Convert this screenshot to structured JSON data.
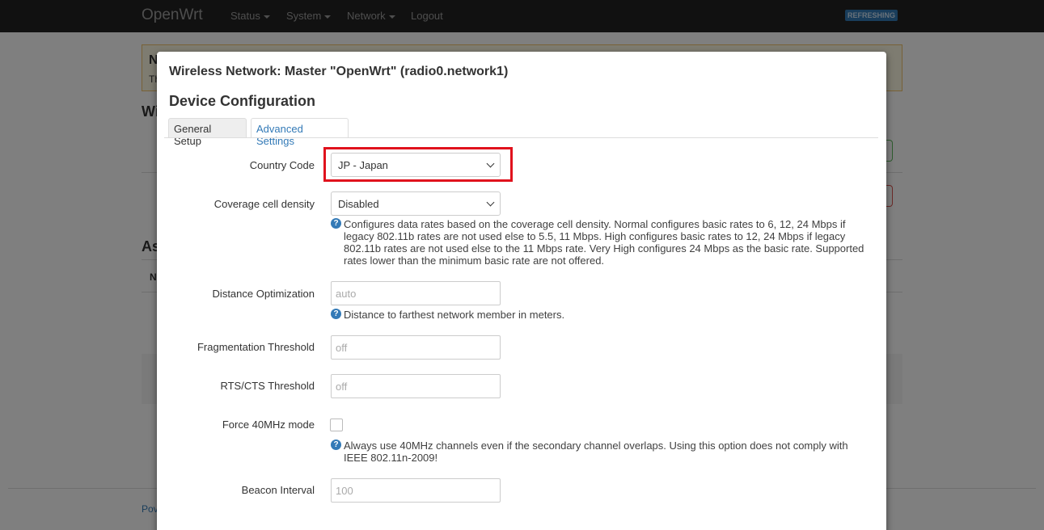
{
  "navbar": {
    "brand": "OpenWrt",
    "items": [
      {
        "label": "Status",
        "dropdown": true
      },
      {
        "label": "System",
        "dropdown": true
      },
      {
        "label": "Network",
        "dropdown": true
      },
      {
        "label": "Logout",
        "dropdown": false
      }
    ],
    "badge": "REFRESHING"
  },
  "background": {
    "notice_title": "N",
    "notice_text": "Th",
    "heading": "Wi",
    "heading2": "As",
    "row_label": "N",
    "footer": "Pov"
  },
  "modal": {
    "title": "Wireless Network: Master \"OpenWrt\" (radio0.network1)",
    "section": "Device Configuration",
    "tabs": [
      {
        "label": "General Setup",
        "active": false
      },
      {
        "label": "Advanced Settings",
        "active": true
      }
    ],
    "fields": {
      "country_code": {
        "label": "Country Code",
        "value": "JP - Japan"
      },
      "coverage": {
        "label": "Coverage cell density",
        "value": "Disabled",
        "help": [
          "Configures data rates based on the coverage cell density. Normal configures basic rates to 6, 12, 24 Mbps if",
          "legacy 802.11b rates are not used else to 5.5, 11 Mbps. High configures basic rates to 12, 24 Mbps if legacy",
          "802.11b rates are not used else to the 11 Mbps rate. Very High configures 24 Mbps as the basic rate. Supported",
          "rates lower than the minimum basic rate are not offered."
        ]
      },
      "distance": {
        "label": "Distance Optimization",
        "placeholder": "auto",
        "help": "Distance to farthest network member in meters."
      },
      "fragmentation": {
        "label": "Fragmentation Threshold",
        "placeholder": "off"
      },
      "rts_cts": {
        "label": "RTS/CTS Threshold",
        "placeholder": "off"
      },
      "force40": {
        "label": "Force 40MHz mode",
        "checked": false,
        "help": [
          "Always use 40MHz channels even if the secondary channel overlaps. Using this option does not comply with",
          "IEEE 802.11n-2009!"
        ]
      },
      "beacon": {
        "label": "Beacon Interval",
        "placeholder": "100"
      }
    }
  },
  "colors": {
    "navbar_bg": "#222222",
    "accent": "#337ab7",
    "highlight": "#e0121d"
  }
}
